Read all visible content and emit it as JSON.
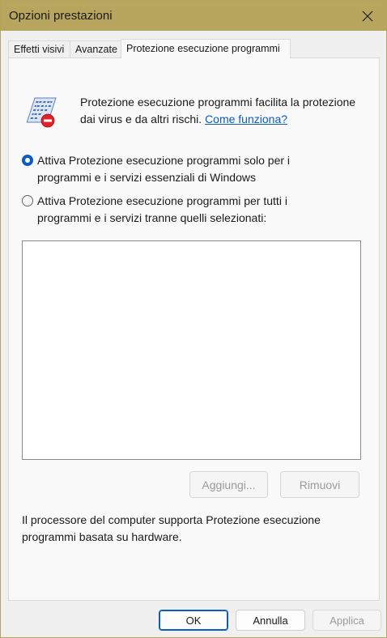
{
  "window": {
    "title": "Opzioni prestazioni"
  },
  "colors": {
    "titlebar": "#b8a55e",
    "accent": "#0a5bc4",
    "panel_bg": "#f9f9f9",
    "window_bg": "#f0f0f0"
  },
  "tabs": [
    {
      "label": "Effetti visivi",
      "active": false
    },
    {
      "label": "Avanzate",
      "active": false
    },
    {
      "label": "Protezione esecuzione programmi",
      "active": true
    }
  ],
  "intro": {
    "text": "Protezione esecuzione programmi facilita la protezione dai virus e da altri rischi.",
    "link": "Come funziona?"
  },
  "options": {
    "essential": {
      "label": "Attiva Protezione esecuzione programmi solo per i programmi e i servizi essenziali di Windows",
      "selected": true
    },
    "all": {
      "label": "Attiva Protezione esecuzione programmi per tutti i programmi e i servizi tranne quelli selezionati:",
      "selected": false
    }
  },
  "exclusions": [],
  "buttons": {
    "add": "Aggiungi...",
    "remove": "Rimuovi",
    "ok": "OK",
    "cancel": "Annulla",
    "apply": "Applica"
  },
  "hardware_note": "Il processore del computer supporta Protezione esecuzione programmi basata su hardware.",
  "icons": {
    "close": "close-icon",
    "dep": "dep-shield-icon",
    "close_glyph": "✕"
  }
}
